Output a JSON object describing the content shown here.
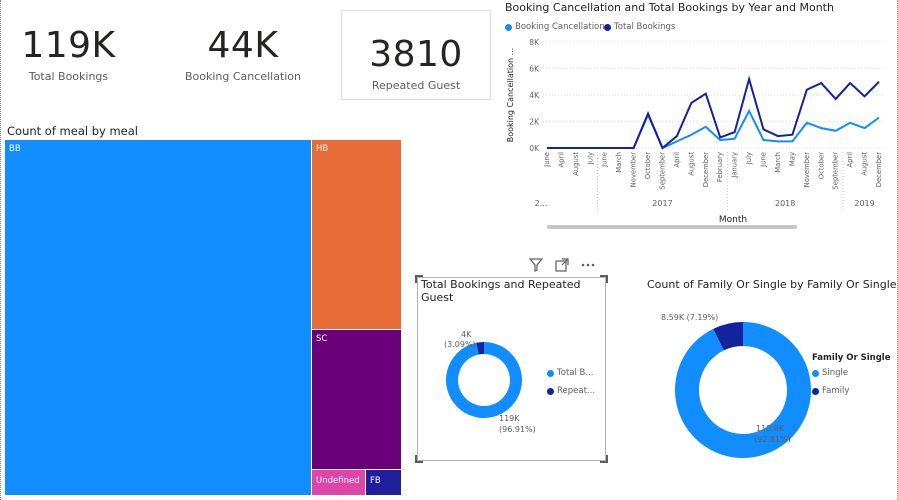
{
  "cards": {
    "total_bookings": {
      "value": "119K",
      "label": "Total Bookings"
    },
    "booking_cancellation": {
      "value": "44K",
      "label": "Booking Cancellation"
    },
    "repeated_guest": {
      "value": "3810",
      "label": "Repeated Guest"
    }
  },
  "treemap": {
    "title": "Count of meal by meal",
    "tiles": [
      {
        "label": "BB",
        "color": "#118DFF"
      },
      {
        "label": "HB",
        "color": "#E66C37"
      },
      {
        "label": "SC",
        "color": "#6B007B"
      },
      {
        "label": "Undefined",
        "color": "#E044A7"
      },
      {
        "label": "FB",
        "color": "#1F1F9E"
      }
    ]
  },
  "line_chart": {
    "title": "Booking Cancellation and Total Bookings by Year and Month",
    "legend": [
      {
        "name": "Booking Cancellation",
        "color": "#118DFF"
      },
      {
        "name": "Total Bookings",
        "color": "#12239E"
      }
    ]
  },
  "chart_data": [
    {
      "type": "line",
      "title": "Booking Cancellation and Total Bookings by Year and Month",
      "xlabel": "Month",
      "ylabel": "Booking Cancellation ...",
      "ylim": [
        0,
        8000
      ],
      "y_ticks": [
        "0K",
        "2K",
        "4K",
        "6K",
        "8K"
      ],
      "x": [
        "June",
        "April",
        "August",
        "July",
        "June",
        "March",
        "November",
        "October",
        "September",
        "April",
        "August",
        "December",
        "February",
        "January",
        "July",
        "June",
        "March",
        "May",
        "November",
        "October",
        "September",
        "April",
        "August",
        "December"
      ],
      "year_labels": [
        {
          "label": "2...",
          "at": 0
        },
        {
          "label": "2017",
          "at": 4
        },
        {
          "label": "2018",
          "at": 13
        },
        {
          "label": "2019",
          "at": 20
        }
      ],
      "series": [
        {
          "name": "Booking Cancellation",
          "values": [
            0,
            0,
            0,
            0,
            0,
            0,
            0,
            2500,
            0,
            500,
            1000,
            1600,
            600,
            700,
            2800,
            600,
            500,
            500,
            1900,
            1500,
            1300,
            1900,
            1500,
            2300
          ]
        },
        {
          "name": "Total Bookings",
          "values": [
            0,
            0,
            0,
            0,
            0,
            0,
            0,
            2600,
            0,
            900,
            3400,
            4100,
            800,
            1200,
            5200,
            1400,
            900,
            1000,
            4400,
            4900,
            3700,
            4900,
            3900,
            5000
          ]
        }
      ]
    },
    {
      "type": "pie",
      "title": "Total Bookings and Repeated Guest",
      "categories": [
        "Total B...",
        "Repeat..."
      ],
      "values": [
        119000,
        4000
      ],
      "data_labels": [
        "119K (96.91%)",
        "4K (3.09%)"
      ],
      "colors": [
        "#118DFF",
        "#12239E"
      ]
    },
    {
      "type": "pie",
      "title": "Count of Family Or Single by Family Or Single",
      "legend_title": "Family Or Single",
      "categories": [
        "Single",
        "Family"
      ],
      "values": [
        110800,
        8590
      ],
      "data_labels": [
        "110.8K (92.81%)",
        "8.59K (7.19%)"
      ],
      "colors": [
        "#118DFF",
        "#12239E"
      ]
    }
  ],
  "donut1": {
    "title_line1": "Total Bookings and Repeated",
    "title_line2": "Guest",
    "legend": [
      {
        "name": "Total B...",
        "color": "#118DFF"
      },
      {
        "name": "Repeat...",
        "color": "#12239E"
      }
    ],
    "label_small_1": "4K",
    "label_small_2": "(3.09%)",
    "label_big_1": "119K",
    "label_big_2": "(96.91%)"
  },
  "donut2": {
    "title": "Count of Family Or Single by Family Or Single",
    "legend_title": "Family Or Single",
    "legend": [
      {
        "name": "Single",
        "color": "#118DFF"
      },
      {
        "name": "Family",
        "color": "#12239E"
      }
    ],
    "label_small": "8.59K (7.19%)",
    "label_big_1": "110.8K",
    "label_big_2": "(92.81%)"
  },
  "header_icons": [
    "filter-icon",
    "focus-mode-icon",
    "more-options-icon"
  ]
}
